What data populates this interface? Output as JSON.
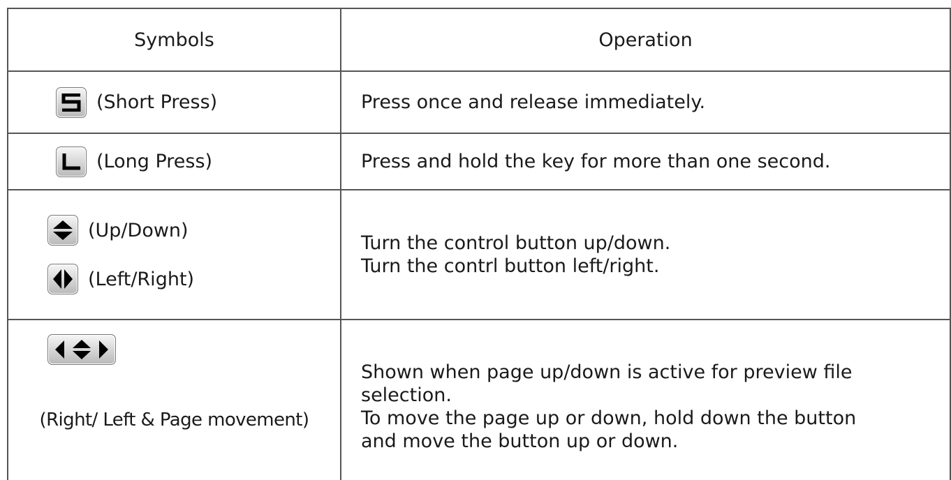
{
  "header": {
    "symbols": "Symbols",
    "operation": "Operation"
  },
  "rows": [
    {
      "icon": "s-key-icon",
      "symbol_label": "(Short Press)",
      "operation": "Press once and release immediately."
    },
    {
      "icon": "l-key-icon",
      "symbol_label": "(Long Press)",
      "operation": "Press and hold the key for more than one second."
    },
    {
      "icons": [
        "up-down-icon",
        "left-right-icon"
      ],
      "symbol_labels": [
        "(Up/Down)",
        "(Left/Right)"
      ],
      "operation_lines": [
        "Turn the control button up/down.",
        "Turn the contrl button left/right."
      ]
    },
    {
      "icon": "left-updown-right-icon",
      "symbol_label": "(Right/ Left & Page movement)",
      "operation_lines": [
        "Shown when page up/down is active for preview file",
        "selection.",
        "To move the page up or down, hold down the button",
        "and move the button up or down."
      ]
    }
  ]
}
